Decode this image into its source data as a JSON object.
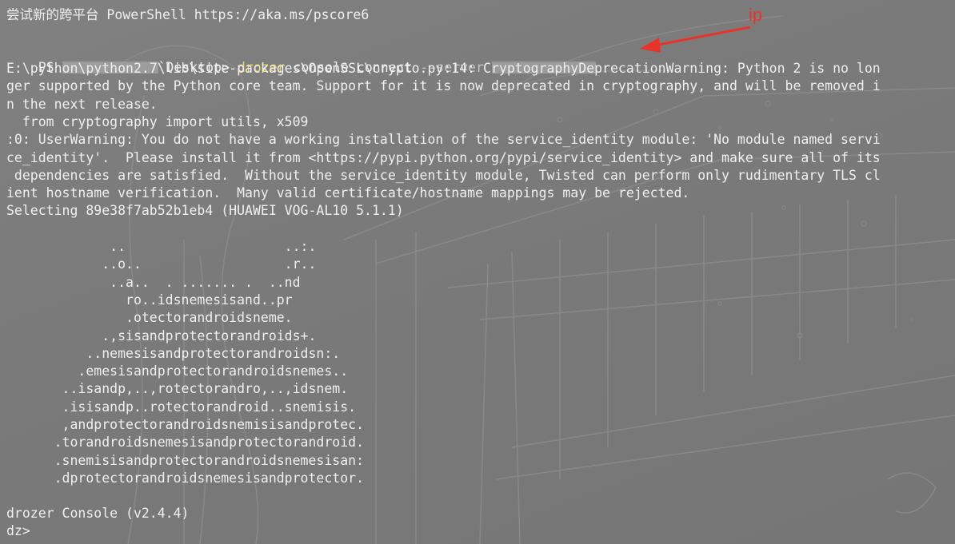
{
  "banner": "尝试新的跨平台 PowerShell https://aka.ms/pscore6",
  "prompt": {
    "ps": "PS ",
    "path_suffix": "`Desktop> ",
    "command": "drozer",
    "args": " console connect ",
    "flag": "--server"
  },
  "annotation": "ip",
  "output": [
    "E:\\python\\python2.7\\lib\\site-packages\\OpenSSL\\crypto.py:14: CryptographyDeprecationWarning: Python 2 is no lon",
    "ger supported by the Python core team. Support for it is now deprecated in cryptography, and will be removed i",
    "n the next release.",
    "  from cryptography import utils, x509",
    ":0: UserWarning: You do not have a working installation of the service_identity module: 'No module named servi",
    "ce_identity'.  Please install it from <https://pypi.python.org/pypi/service_identity> and make sure all of its",
    " dependencies are satisfied.  Without the service_identity module, Twisted can perform only rudimentary TLS cl",
    "ient hostname verification.  Many valid certificate/hostname mappings may be rejected.",
    "Selecting 89e38f7ab52b1eb4 (HUAWEI VOG-AL10 5.1.1)"
  ],
  "ascii_art": [
    "             ..                    ..:.",
    "            ..o..                  .r..",
    "             ..a..  . ....... .  ..nd",
    "               ro..idsnemesisand..pr",
    "               .otectorandroidsneme.",
    "            .,sisandprotectorandroids+.",
    "          ..nemesisandprotectorandroidsn:.",
    "         .emesisandprotectorandroidsnemes..",
    "       ..isandp,..,rotectorandro,..,idsnem.",
    "       .isisandp..rotectorandroid..snemisis.",
    "       ,andprotectorandroidsnemisisandprotec.",
    "      .torandroidsnemesisandprotectorandroid.",
    "      .snemisisandprotectorandroidsnemesisan:",
    "      .dprotectorandroidsnemesisandprotector."
  ],
  "console_version": "drozer Console (v2.4.4)",
  "dz_prompt": "dz>"
}
